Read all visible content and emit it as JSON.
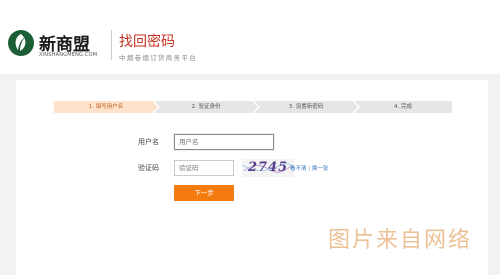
{
  "header": {
    "logo_text": "新商盟",
    "logo_sub": "XINSHANGMENG.COM",
    "page_title": "找回密码",
    "page_subtitle": "中烟卷烟订货商务平台"
  },
  "steps": [
    {
      "label": "1. 填写用户名",
      "active": true
    },
    {
      "label": "2. 验证身份",
      "active": false
    },
    {
      "label": "3. 设置新密码",
      "active": false
    },
    {
      "label": "4. 完成",
      "active": false
    }
  ],
  "form": {
    "username_label": "用户名",
    "username_placeholder": "用户名",
    "captcha_label": "验证码",
    "captcha_placeholder": "验证码",
    "captcha_text": "2745",
    "cant_see_link": "看不清",
    "separator": "|",
    "refresh_link": "换一张",
    "next_button": "下一步"
  },
  "watermark": "图片来自网络",
  "colors": {
    "brand_green": "#1c5e35",
    "title_red": "#c7301e",
    "active_step": "#fde3cc",
    "inactive_step": "#e6e6e6",
    "button_orange": "#f47c0f",
    "link_blue": "#3a78c3"
  }
}
